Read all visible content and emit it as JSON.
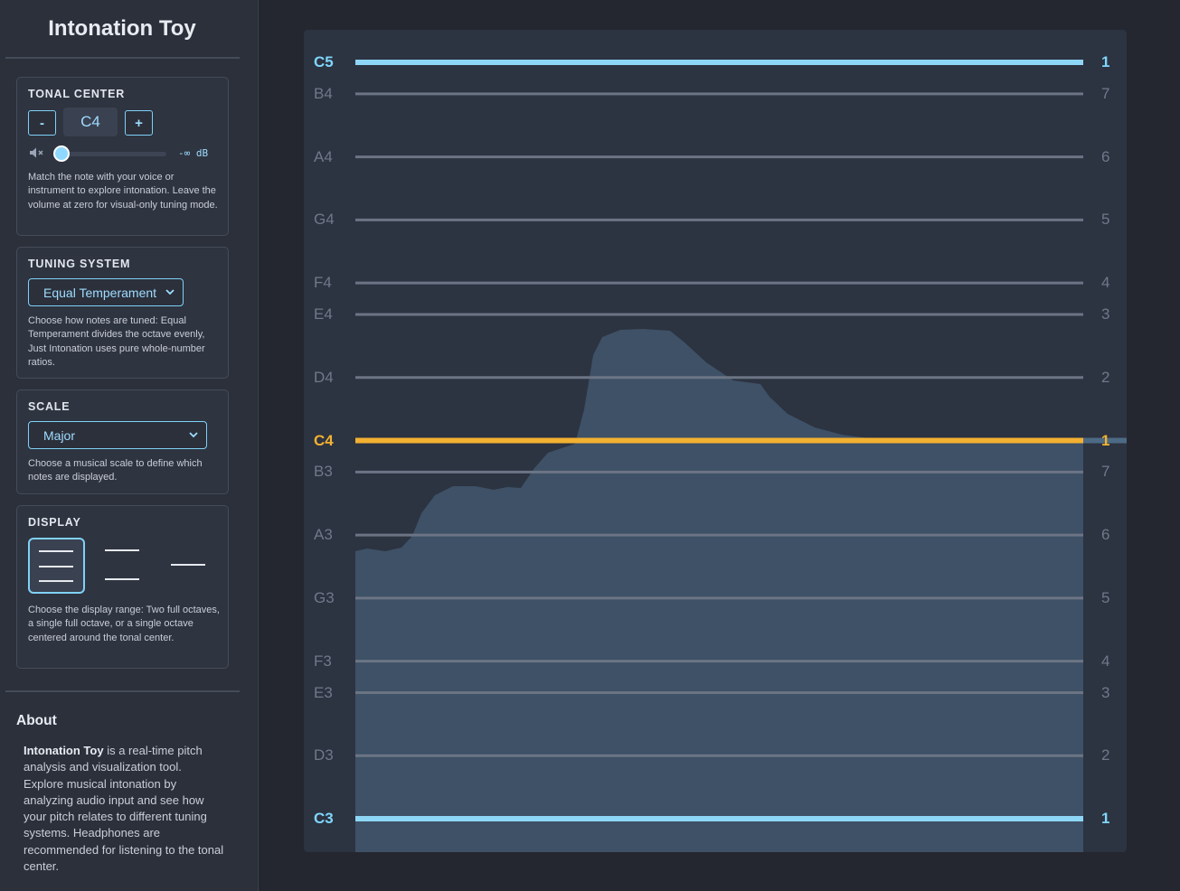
{
  "app": {
    "title": "Intonation Toy"
  },
  "tonal_center": {
    "heading": "TONAL CENTER",
    "decrement_label": "-",
    "increment_label": "+",
    "note": "C4",
    "volume_db": "-∞ dB",
    "volume_level": 0,
    "help": "Match the note with your voice or instrument to explore intonation. Leave the volume at zero for visual-only tuning mode."
  },
  "tuning_system": {
    "heading": "TUNING SYSTEM",
    "selected": "Equal Temperament",
    "help": "Choose how notes are tuned: Equal Temperament divides the octave evenly, Just Intonation uses pure whole-number ratios."
  },
  "scale": {
    "heading": "SCALE",
    "selected": "Major",
    "help": "Choose a musical scale to define which notes are displayed."
  },
  "display": {
    "heading": "DISPLAY",
    "options": [
      "Two full octaves",
      "Single full octave",
      "Single octave centered"
    ],
    "selected_index": 0,
    "help": "Choose the display range: Two full octaves, a single full octave, or a single octave centered around the tonal center."
  },
  "about": {
    "heading": "About",
    "app_name": "Intonation Toy",
    "text": " is a real-time pitch analysis and visualization tool. Explore musical intonation by analyzing audio input and see how your pitch relates to different tuning systems. Headphones are recommended for listening to the tonal center."
  },
  "pitch_display": {
    "notes": [
      {
        "note": "C5",
        "degree": "1",
        "role": "tonic"
      },
      {
        "note": "B4",
        "degree": "7",
        "role": "scale"
      },
      {
        "note": "A4",
        "degree": "6",
        "role": "scale"
      },
      {
        "note": "G4",
        "degree": "5",
        "role": "scale"
      },
      {
        "note": "F4",
        "degree": "4",
        "role": "scale"
      },
      {
        "note": "E4",
        "degree": "3",
        "role": "scale"
      },
      {
        "note": "D4",
        "degree": "2",
        "role": "scale"
      },
      {
        "note": "C4",
        "degree": "1",
        "role": "center"
      },
      {
        "note": "B3",
        "degree": "7",
        "role": "scale"
      },
      {
        "note": "A3",
        "degree": "6",
        "role": "scale"
      },
      {
        "note": "G3",
        "degree": "5",
        "role": "scale"
      },
      {
        "note": "F3",
        "degree": "4",
        "role": "scale"
      },
      {
        "note": "E3",
        "degree": "3",
        "role": "scale"
      },
      {
        "note": "D3",
        "degree": "2",
        "role": "scale"
      },
      {
        "note": "C3",
        "degree": "1",
        "role": "tonic"
      }
    ],
    "colors": {
      "tonic": "#8ed6f6",
      "center": "#f3b131",
      "scale": "#6c7585",
      "pitch_fill": "#3e5166"
    }
  }
}
